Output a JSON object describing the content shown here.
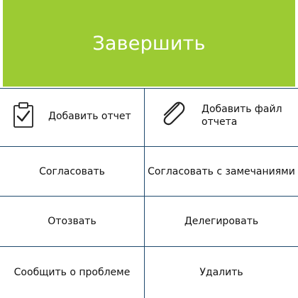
{
  "header": {
    "finish_label": "Завершить",
    "background_color": "#9ccb33"
  },
  "actions": {
    "add_report_label": "Добавить отчет",
    "add_report_file_label_line1": "Добавить файл",
    "add_report_file_label_line2": "отчета",
    "approve_label": "Согласовать",
    "approve_with_remarks_label": "Согласовать с замечаниями",
    "recall_label": "Отозвать",
    "delegate_label": "Делегировать",
    "report_problem_label": "Сообщить о проблеме",
    "delete_label": "Удалить"
  },
  "icons": {
    "add_report_icon": "clipboard-check-icon",
    "add_file_icon": "paperclip-icon"
  },
  "colors": {
    "divider": "#1f4a6e",
    "text": "#111111"
  }
}
